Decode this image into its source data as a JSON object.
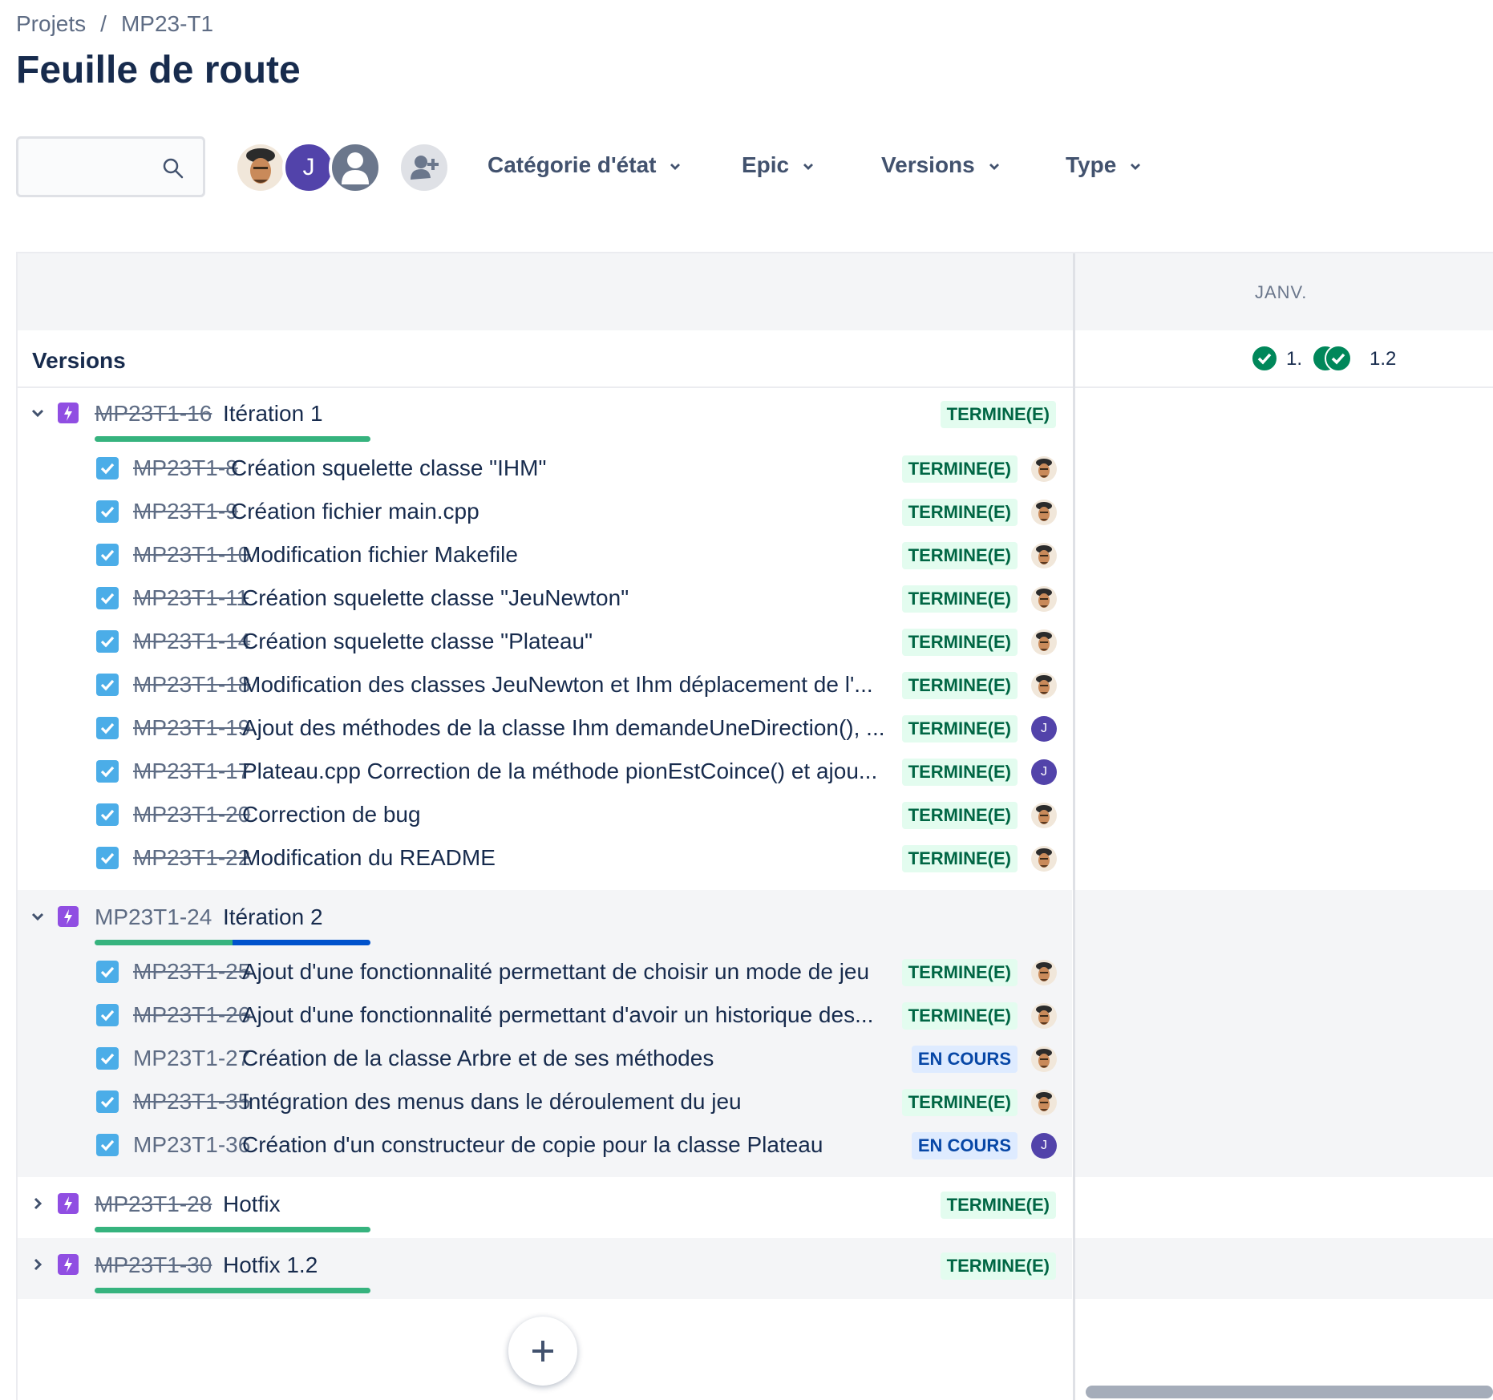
{
  "breadcrumb": {
    "projects": "Projets",
    "separator": "/",
    "project": "MP23-T1"
  },
  "page": {
    "title": "Feuille de route"
  },
  "search": {
    "placeholder": ""
  },
  "avatars": {
    "user_j_initial": "J"
  },
  "filters": {
    "status_category": "Catégorie d'état",
    "epic": "Epic",
    "versions": "Versions",
    "type": "Type"
  },
  "timeline": {
    "month": "JANV."
  },
  "versions": {
    "label": "Versions",
    "v1": "1.",
    "v2": "1.2"
  },
  "colors": {
    "done_bg": "#e3fcef",
    "done_text": "#006644",
    "progress_bg": "#deebff",
    "progress_text": "#0747a6",
    "epic": "#904ee2",
    "task": "#4bade8",
    "bar_done": "#36b37e",
    "bar_progress": "#0052cc"
  },
  "epics": [
    {
      "key": "MP23T1-16",
      "title": "Itération 1",
      "status": "TERMINE(E)",
      "done": true,
      "progress_done": 1.0,
      "progress_in_progress": 0.0,
      "issues": [
        {
          "key": "MP23T1-8",
          "summary": "Création squelette classe \"IHM\"",
          "status": "TERMINE(E)",
          "assignee": "photo"
        },
        {
          "key": "MP23T1-9",
          "summary": "Création fichier main.cpp",
          "status": "TERMINE(E)",
          "assignee": "photo"
        },
        {
          "key": "MP23T1-10",
          "summary": "Modification fichier Makefile",
          "status": "TERMINE(E)",
          "assignee": "photo"
        },
        {
          "key": "MP23T1-11",
          "summary": "Création squelette classe \"JeuNewton\"",
          "status": "TERMINE(E)",
          "assignee": "photo"
        },
        {
          "key": "MP23T1-14",
          "summary": "Création squelette classe \"Plateau\"",
          "status": "TERMINE(E)",
          "assignee": "photo"
        },
        {
          "key": "MP23T1-18",
          "summary": "Modification des classes JeuNewton et Ihm déplacement de l'...",
          "status": "TERMINE(E)",
          "assignee": "photo"
        },
        {
          "key": "MP23T1-19",
          "summary": "Ajout des méthodes de la classe Ihm demandeUneDirection(), ...",
          "status": "TERMINE(E)",
          "assignee": "J"
        },
        {
          "key": "MP23T1-17",
          "summary": "Plateau.cpp Correction de la méthode pionEstCoince() et ajou...",
          "status": "TERMINE(E)",
          "assignee": "J"
        },
        {
          "key": "MP23T1-20",
          "summary": "Correction de bug",
          "status": "TERMINE(E)",
          "assignee": "photo"
        },
        {
          "key": "MP23T1-22",
          "summary": "Modification du README",
          "status": "TERMINE(E)",
          "assignee": "photo"
        }
      ]
    },
    {
      "key": "MP23T1-24",
      "title": "Itération 2",
      "status": "",
      "done": false,
      "progress_done": 0.5,
      "progress_in_progress": 0.5,
      "issues": [
        {
          "key": "MP23T1-25",
          "summary": "Ajout d'une fonctionnalité permettant de choisir un mode de jeu",
          "status": "TERMINE(E)",
          "assignee": "photo"
        },
        {
          "key": "MP23T1-26",
          "summary": "Ajout d'une fonctionnalité permettant d'avoir un historique des...",
          "status": "TERMINE(E)",
          "assignee": "photo"
        },
        {
          "key": "MP23T1-27",
          "summary": "Création de la classe Arbre et de ses méthodes",
          "status": "EN COURS",
          "assignee": "photo"
        },
        {
          "key": "MP23T1-35",
          "summary": "Intégration des menus dans le déroulement du jeu",
          "status": "TERMINE(E)",
          "assignee": "photo"
        },
        {
          "key": "MP23T1-36",
          "summary": "Création d'un constructeur de copie pour la classe Plateau",
          "status": "EN COURS",
          "assignee": "J"
        }
      ]
    },
    {
      "key": "MP23T1-28",
      "title": "Hotfix",
      "status": "TERMINE(E)",
      "done": true,
      "progress_done": 1.0,
      "progress_in_progress": 0.0,
      "issues": []
    },
    {
      "key": "MP23T1-30",
      "title": "Hotfix 1.2",
      "status": "TERMINE(E)",
      "done": true,
      "progress_done": 1.0,
      "progress_in_progress": 0.0,
      "issues": []
    }
  ]
}
